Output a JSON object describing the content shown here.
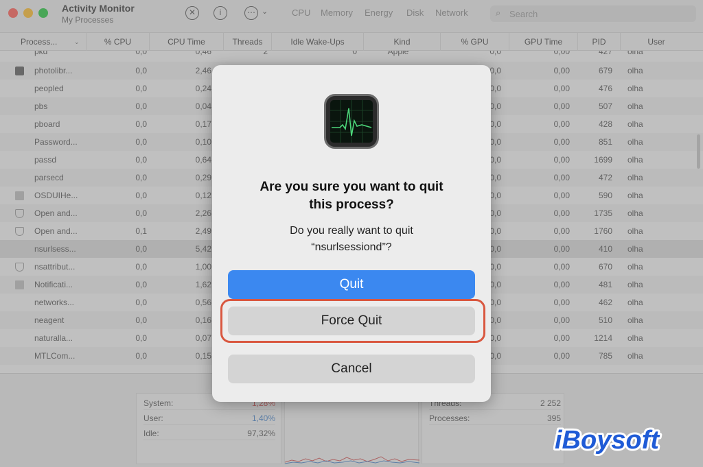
{
  "window": {
    "title": "Activity Monitor",
    "subtitle": "My Processes",
    "tabs": [
      "CPU",
      "Memory",
      "Energy",
      "Disk",
      "Network"
    ],
    "search_placeholder": "Search"
  },
  "columns": [
    "Process...",
    "% CPU",
    "CPU Time",
    "Threads",
    "Idle Wake-Ups",
    "Kind",
    "% GPU",
    "GPU Time",
    "PID",
    "User"
  ],
  "partial_top_row": {
    "process": "pkd",
    "cpu": "0,0",
    "cpu_time": "0,46",
    "threads": "2",
    "idle": "0",
    "kind": "Apple",
    "gpu": "0,0",
    "gpu_time": "0,00",
    "pid": "427",
    "user": "olha"
  },
  "rows": [
    {
      "process": "photolibr...",
      "cpu": "0,0",
      "cpu_time": "2,46",
      "gpu": "0,0",
      "gpu_time": "0,00",
      "pid": "679",
      "user": "olha",
      "icon": "photos-icon"
    },
    {
      "process": "peopled",
      "cpu": "0,0",
      "cpu_time": "0,24",
      "gpu": "0,0",
      "gpu_time": "0,00",
      "pid": "476",
      "user": "olha",
      "icon": ""
    },
    {
      "process": "pbs",
      "cpu": "0,0",
      "cpu_time": "0,04",
      "gpu": "0,0",
      "gpu_time": "0,00",
      "pid": "507",
      "user": "olha",
      "icon": ""
    },
    {
      "process": "pboard",
      "cpu": "0,0",
      "cpu_time": "0,17",
      "gpu": "0,0",
      "gpu_time": "0,00",
      "pid": "428",
      "user": "olha",
      "icon": ""
    },
    {
      "process": "Password...",
      "cpu": "0,0",
      "cpu_time": "0,10",
      "gpu": "0,0",
      "gpu_time": "0,00",
      "pid": "851",
      "user": "olha",
      "icon": ""
    },
    {
      "process": "passd",
      "cpu": "0,0",
      "cpu_time": "0,64",
      "gpu": "0,0",
      "gpu_time": "0,00",
      "pid": "1699",
      "user": "olha",
      "icon": ""
    },
    {
      "process": "parsecd",
      "cpu": "0,0",
      "cpu_time": "0,29",
      "gpu": "0,0",
      "gpu_time": "0,00",
      "pid": "472",
      "user": "olha",
      "icon": ""
    },
    {
      "process": "OSDUIHe...",
      "cpu": "0,0",
      "cpu_time": "0,12",
      "gpu": "0,0",
      "gpu_time": "0,00",
      "pid": "590",
      "user": "olha",
      "icon": "document-icon"
    },
    {
      "process": "Open and...",
      "cpu": "0,0",
      "cpu_time": "2,26",
      "gpu": "0,0",
      "gpu_time": "0,00",
      "pid": "1735",
      "user": "olha",
      "icon": "shield-icon"
    },
    {
      "process": "Open and...",
      "cpu": "0,1",
      "cpu_time": "2,49",
      "gpu": "0,0",
      "gpu_time": "0,00",
      "pid": "1760",
      "user": "olha",
      "icon": "shield-icon"
    },
    {
      "process": "nsurlsess...",
      "cpu": "0,0",
      "cpu_time": "5,42",
      "gpu": "0,0",
      "gpu_time": "0,00",
      "pid": "410",
      "user": "olha",
      "icon": "",
      "selected": true
    },
    {
      "process": "nsattribut...",
      "cpu": "0,0",
      "cpu_time": "1,00",
      "gpu": "0,0",
      "gpu_time": "0,00",
      "pid": "670",
      "user": "olha",
      "icon": "shield-icon"
    },
    {
      "process": "Notificati...",
      "cpu": "0,0",
      "cpu_time": "1,62",
      "gpu": "0,0",
      "gpu_time": "0,00",
      "pid": "481",
      "user": "olha",
      "icon": "document-icon"
    },
    {
      "process": "networks...",
      "cpu": "0,0",
      "cpu_time": "0,56",
      "gpu": "0,0",
      "gpu_time": "0,00",
      "pid": "462",
      "user": "olha",
      "icon": ""
    },
    {
      "process": "neagent",
      "cpu": "0,0",
      "cpu_time": "0,16",
      "gpu": "0,0",
      "gpu_time": "0,00",
      "pid": "510",
      "user": "olha",
      "icon": ""
    },
    {
      "process": "naturalla...",
      "cpu": "0,0",
      "cpu_time": "0,07",
      "gpu": "0,0",
      "gpu_time": "0,00",
      "pid": "1214",
      "user": "olha",
      "icon": ""
    },
    {
      "process": "MTLCom...",
      "cpu": "0,0",
      "cpu_time": "0,15",
      "gpu": "0,0",
      "gpu_time": "0,00",
      "pid": "785",
      "user": "olha",
      "icon": ""
    }
  ],
  "stats": {
    "system_label": "System:",
    "system_value": "1,28%",
    "user_label": "User:",
    "user_value": "1,40%",
    "idle_label": "Idle:",
    "idle_value": "97,32%",
    "threads_label": "Threads:",
    "threads_value": "2 252",
    "processes_label": "Processes:",
    "processes_value": "395"
  },
  "dialog": {
    "title_line1": "Are you sure you want to quit",
    "title_line2": "this process?",
    "message_line1": "Do you really want to quit",
    "message_line2": "“nsurlsessiond”?",
    "quit_label": "Quit",
    "force_quit_label": "Force Quit",
    "cancel_label": "Cancel"
  },
  "watermark": {
    "text": "iBoysoft"
  },
  "colors": {
    "accent": "#3b88f0",
    "highlight": "#d9573f",
    "logo": "#1f5bd6"
  }
}
